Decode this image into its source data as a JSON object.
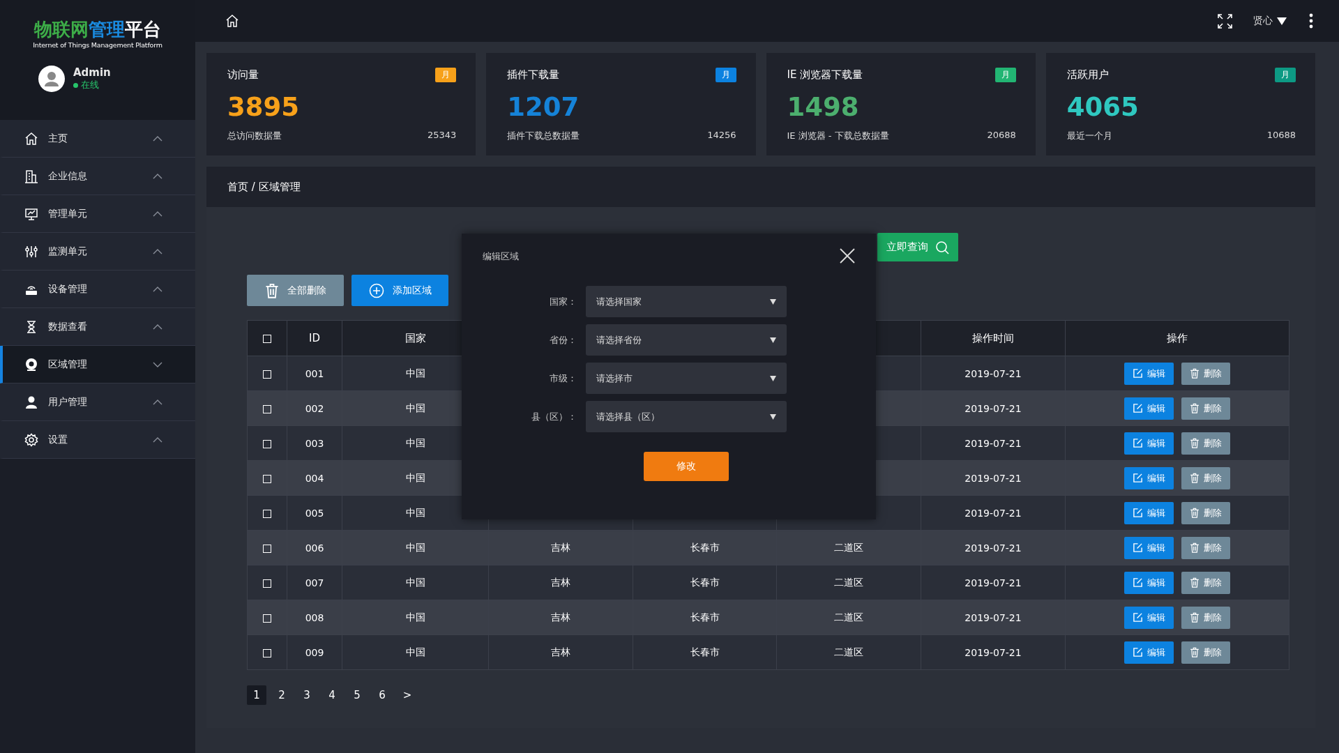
{
  "logo": {
    "parts": [
      {
        "text": "物联网",
        "color": "#3dae48"
      },
      {
        "text": "管理",
        "color": "#1a8be0"
      },
      {
        "text": "平台",
        "color": "#ffffff"
      }
    ],
    "subtitle": "Internet of Things Management Platform"
  },
  "user": {
    "name": "Admin",
    "status": "在线",
    "online": true
  },
  "sidebar": {
    "items": [
      {
        "kind": "home",
        "label": "主页",
        "selected": false,
        "expanded": false
      },
      {
        "kind": "building",
        "label": "企业信息",
        "selected": false,
        "expanded": false
      },
      {
        "kind": "monitor",
        "label": "管理单元",
        "selected": false,
        "expanded": false
      },
      {
        "kind": "sliders",
        "label": "监测单元",
        "selected": false,
        "expanded": false
      },
      {
        "kind": "router",
        "label": "设备管理",
        "selected": false,
        "expanded": false
      },
      {
        "kind": "hourglass",
        "label": "数据查看",
        "selected": false,
        "expanded": false
      },
      {
        "kind": "camera",
        "label": "区域管理",
        "selected": true,
        "expanded": true
      },
      {
        "kind": "user",
        "label": "用户管理",
        "selected": false,
        "expanded": false
      },
      {
        "kind": "gear",
        "label": "设置",
        "selected": false,
        "expanded": false
      }
    ]
  },
  "topbar": {
    "user": "贤心"
  },
  "stats": [
    {
      "title": "访问量",
      "badge": {
        "text": "月",
        "color": "#f7a11a"
      },
      "value": "3895",
      "color": "#f7a11a",
      "footer_label": "总访问数据量",
      "footer_value": "25343"
    },
    {
      "title": "插件下载量",
      "badge": {
        "text": "月",
        "color": "#0c82e0"
      },
      "value": "1207",
      "color": "#1583d8",
      "footer_label": "插件下载总数据量",
      "footer_value": "14256"
    },
    {
      "title": "IE 浏览器下载量",
      "badge": {
        "text": "月",
        "color": "#22b573"
      },
      "value": "1498",
      "color": "#4caf6e",
      "footer_label": "IE 浏览器 - 下载总数据量",
      "footer_value": "20688"
    },
    {
      "title": "活跃用户",
      "badge": {
        "text": "月",
        "color": "#0d9a84"
      },
      "value": "4065",
      "color": "#2fc8c0",
      "footer_label": "最近一个月",
      "footer_value": "10688"
    }
  ],
  "breadcrumb": "首页 / 区域管理",
  "search": {
    "button": "立即查询"
  },
  "actions": [
    {
      "kind": "delete",
      "label": "全部删除"
    },
    {
      "kind": "add",
      "label": "添加区域"
    }
  ],
  "table": {
    "select_all": {
      "checked": false
    },
    "columns": [
      "ID",
      "国家",
      "操作时间",
      "操作"
    ],
    "rows": [
      {
        "checked": false,
        "id": "001",
        "country": "中国",
        "time": "2019-07-21",
        "edit": "编辑",
        "delete": "删除"
      },
      {
        "checked": false,
        "id": "002",
        "country": "中国",
        "time": "2019-07-21",
        "edit": "编辑",
        "delete": "删除"
      },
      {
        "checked": false,
        "id": "003",
        "country": "中国",
        "time": "2019-07-21",
        "edit": "编辑",
        "delete": "删除"
      },
      {
        "checked": false,
        "id": "004",
        "country": "中国",
        "time": "2019-07-21",
        "edit": "编辑",
        "delete": "删除"
      },
      {
        "checked": false,
        "id": "005",
        "country": "中国",
        "time": "2019-07-21",
        "edit": "编辑",
        "delete": "删除"
      },
      {
        "checked": false,
        "id": "006",
        "country": "中国",
        "province": "吉林",
        "city": "长春市",
        "district": "二道区",
        "time": "2019-07-21",
        "edit": "编辑",
        "delete": "删除"
      },
      {
        "checked": false,
        "id": "007",
        "country": "中国",
        "province": "吉林",
        "city": "长春市",
        "district": "二道区",
        "time": "2019-07-21",
        "edit": "编辑",
        "delete": "删除"
      },
      {
        "checked": false,
        "id": "008",
        "country": "中国",
        "province": "吉林",
        "city": "长春市",
        "district": "二道区",
        "time": "2019-07-21",
        "edit": "编辑",
        "delete": "删除"
      },
      {
        "checked": false,
        "id": "009",
        "country": "中国",
        "province": "吉林",
        "city": "长春市",
        "district": "二道区",
        "time": "2019-07-21",
        "edit": "编辑",
        "delete": "删除"
      }
    ]
  },
  "pagination": {
    "pages": [
      {
        "label": "1",
        "selected": true
      },
      {
        "label": "2",
        "selected": false
      },
      {
        "label": "3",
        "selected": false
      },
      {
        "label": "4",
        "selected": false
      },
      {
        "label": "5",
        "selected": false
      },
      {
        "label": "6",
        "selected": false
      }
    ],
    "next": ">"
  },
  "modal": {
    "title": "编辑区域",
    "fields": [
      {
        "label": "国家：",
        "placeholder": "请选择国家"
      },
      {
        "label": "省份：",
        "placeholder": "请选择省份"
      },
      {
        "label": "市级：",
        "placeholder": "请选择市"
      },
      {
        "label": "县（区）：",
        "placeholder": "请选择县（区）"
      }
    ],
    "submit": "修改"
  }
}
